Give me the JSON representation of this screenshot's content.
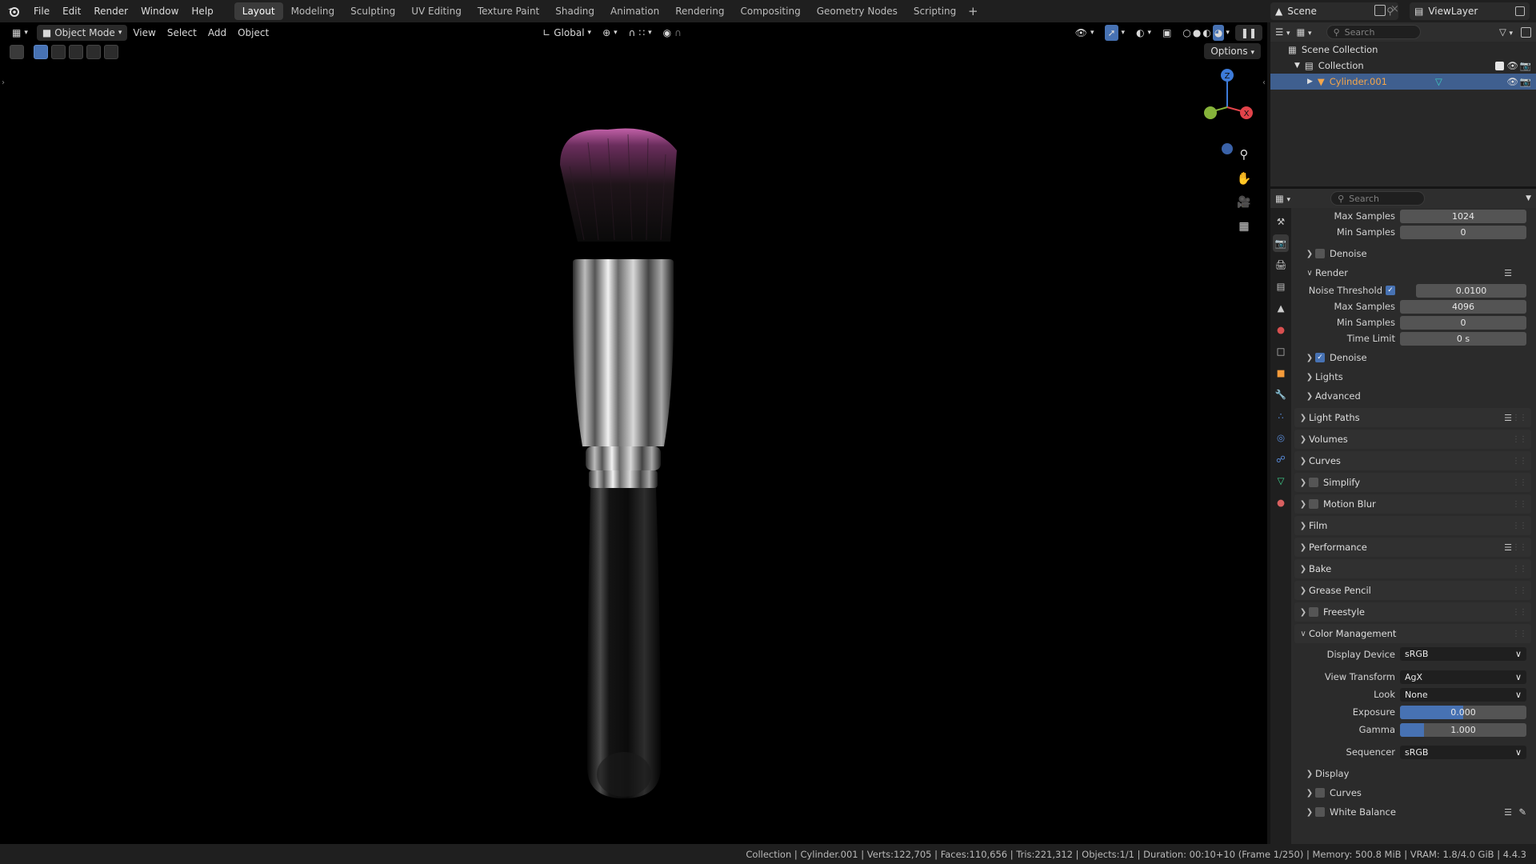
{
  "topbar": {
    "menu": [
      "File",
      "Edit",
      "Render",
      "Window",
      "Help"
    ],
    "workspaces": [
      "Layout",
      "Modeling",
      "Sculpting",
      "UV Editing",
      "Texture Paint",
      "Shading",
      "Animation",
      "Rendering",
      "Compositing",
      "Geometry Nodes",
      "Scripting"
    ],
    "active_workspace": "Layout",
    "add_workspace": "+",
    "scene": "Scene",
    "view_layer": "ViewLayer"
  },
  "viewport": {
    "mode": "Object Mode",
    "menus": [
      "View",
      "Select",
      "Add",
      "Object"
    ],
    "transform_orientation": "Global",
    "options_label": "Options",
    "gizmo_z_label": "Z",
    "gizmo_x_label": "X"
  },
  "outliner": {
    "search_placeholder": "Search",
    "scene_collection": "Scene Collection",
    "collection": "Collection",
    "object": "Cylinder.001"
  },
  "properties": {
    "search_placeholder": "Search",
    "viewport_max_samples_label": "Max Samples",
    "viewport_max_samples": "1024",
    "viewport_min_samples_label": "Min Samples",
    "viewport_min_samples": "0",
    "viewport_denoise_label": "Denoise",
    "render_label": "Render",
    "noise_threshold_label": "Noise Threshold",
    "noise_threshold": "0.0100",
    "render_max_samples_label": "Max Samples",
    "render_max_samples": "4096",
    "render_min_samples_label": "Min Samples",
    "render_min_samples": "0",
    "time_limit_label": "Time Limit",
    "time_limit": "0 s",
    "render_denoise_label": "Denoise",
    "lights_label": "Lights",
    "advanced_label": "Advanced",
    "panels": [
      "Light Paths",
      "Volumes",
      "Curves",
      "Simplify",
      "Motion Blur",
      "Film",
      "Performance",
      "Bake",
      "Grease Pencil",
      "Freestyle"
    ],
    "color_management": {
      "title": "Color Management",
      "display_device_label": "Display Device",
      "display_device": "sRGB",
      "view_transform_label": "View Transform",
      "view_transform": "AgX",
      "look_label": "Look",
      "look": "None",
      "exposure_label": "Exposure",
      "exposure": "0.000",
      "exposure_fill": 0.5,
      "gamma_label": "Gamma",
      "gamma": "1.000",
      "gamma_fill": 0.19,
      "sequencer_label": "Sequencer",
      "sequencer": "sRGB",
      "display_label": "Display",
      "curves_label": "Curves",
      "white_balance_label": "White Balance"
    }
  },
  "statusbar": {
    "text": "Collection | Cylinder.001 | Verts:122,705 | Faces:110,656 | Tris:221,312 | Objects:1/1 | Duration: 00:10+10 (Frame 1/250) | Memory: 500.8 MiB | VRAM: 1.8/4.0 GiB | 4.4.3"
  },
  "colors": {
    "accent": "#4772b3",
    "selected_object": "#f5a64a",
    "bristle": "#c060a0"
  }
}
